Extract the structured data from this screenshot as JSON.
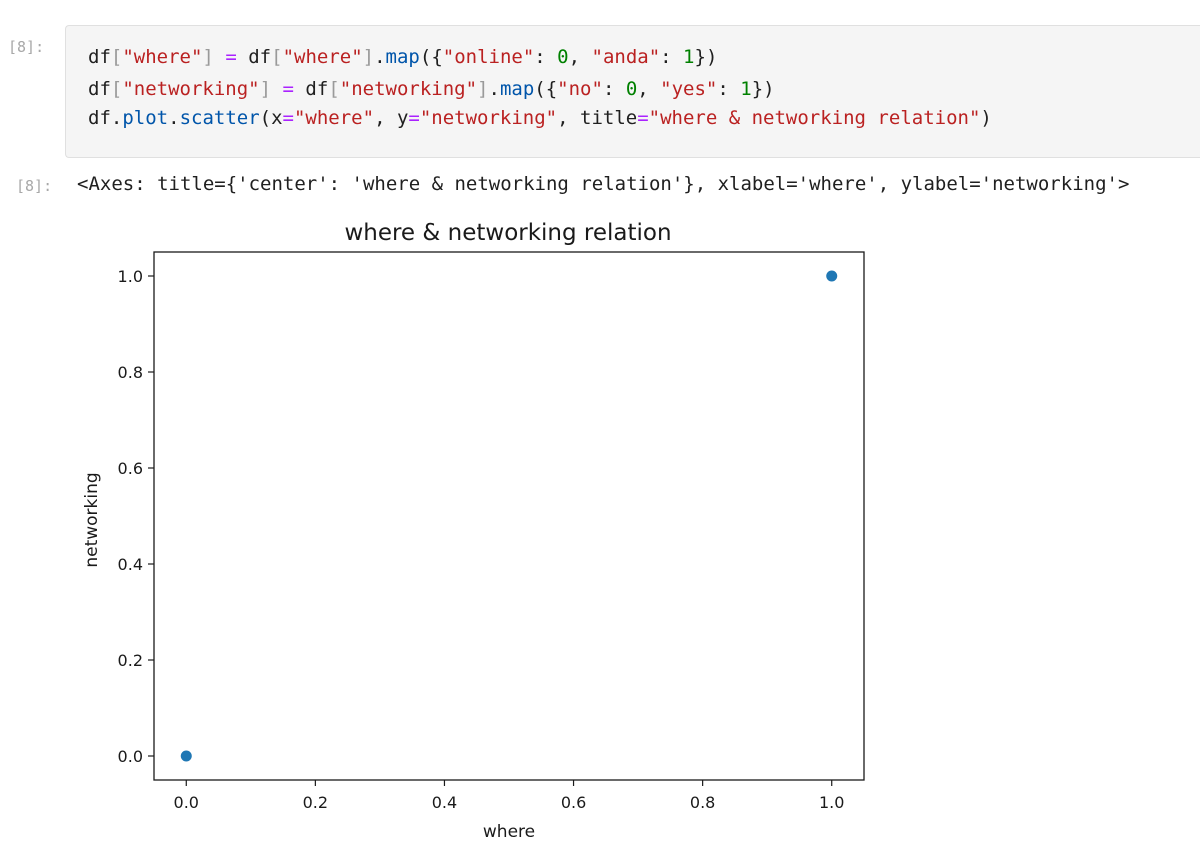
{
  "notebook": {
    "input_prompt": "[8]:",
    "output_prompt": "[8]:",
    "code_lines": [
      [
        {
          "t": "df",
          "c": "plain"
        },
        {
          "t": "[",
          "c": "br"
        },
        {
          "t": "\"where\"",
          "c": "str"
        },
        {
          "t": "]",
          "c": "br"
        },
        {
          "t": " ",
          "c": "plain"
        },
        {
          "t": "=",
          "c": "op"
        },
        {
          "t": " df",
          "c": "plain"
        },
        {
          "t": "[",
          "c": "br"
        },
        {
          "t": "\"where\"",
          "c": "str"
        },
        {
          "t": "]",
          "c": "br"
        },
        {
          "t": ".",
          "c": "plain"
        },
        {
          "t": "map",
          "c": "fn"
        },
        {
          "t": "({",
          "c": "plain"
        },
        {
          "t": "\"online\"",
          "c": "str"
        },
        {
          "t": ": ",
          "c": "plain"
        },
        {
          "t": "0",
          "c": "num"
        },
        {
          "t": ", ",
          "c": "plain"
        },
        {
          "t": "\"anda\"",
          "c": "str"
        },
        {
          "t": ": ",
          "c": "plain"
        },
        {
          "t": "1",
          "c": "num"
        },
        {
          "t": "})",
          "c": "plain"
        }
      ],
      [
        {
          "t": "df",
          "c": "plain"
        },
        {
          "t": "[",
          "c": "br"
        },
        {
          "t": "\"networking\"",
          "c": "str"
        },
        {
          "t": "]",
          "c": "br"
        },
        {
          "t": " ",
          "c": "plain"
        },
        {
          "t": "=",
          "c": "op"
        },
        {
          "t": " df",
          "c": "plain"
        },
        {
          "t": "[",
          "c": "br"
        },
        {
          "t": "\"networking\"",
          "c": "str"
        },
        {
          "t": "]",
          "c": "br"
        },
        {
          "t": ".",
          "c": "plain"
        },
        {
          "t": "map",
          "c": "fn"
        },
        {
          "t": "({",
          "c": "plain"
        },
        {
          "t": "\"no\"",
          "c": "str"
        },
        {
          "t": ": ",
          "c": "plain"
        },
        {
          "t": "0",
          "c": "num"
        },
        {
          "t": ", ",
          "c": "plain"
        },
        {
          "t": "\"yes\"",
          "c": "str"
        },
        {
          "t": ": ",
          "c": "plain"
        },
        {
          "t": "1",
          "c": "num"
        },
        {
          "t": "})",
          "c": "plain"
        }
      ],
      [
        {
          "t": "df",
          "c": "plain"
        },
        {
          "t": ".",
          "c": "plain"
        },
        {
          "t": "plot",
          "c": "fn"
        },
        {
          "t": ".",
          "c": "plain"
        },
        {
          "t": "scatter",
          "c": "fn"
        },
        {
          "t": "(x",
          "c": "plain"
        },
        {
          "t": "=",
          "c": "op"
        },
        {
          "t": "\"where\"",
          "c": "str"
        },
        {
          "t": ", y",
          "c": "plain"
        },
        {
          "t": "=",
          "c": "op"
        },
        {
          "t": "\"networking\"",
          "c": "str"
        },
        {
          "t": ", title",
          "c": "plain"
        },
        {
          "t": "=",
          "c": "op"
        },
        {
          "t": "\"where & networking relation\"",
          "c": "str"
        },
        {
          "t": ")",
          "c": "plain"
        }
      ]
    ],
    "output_text": "<Axes: title={'center': 'where & networking relation'}, xlabel='where', ylabel='networking'>"
  },
  "colors": {
    "marker": "#1f77b4",
    "string": "#ba2121",
    "operator": "#aa22ff",
    "number": "#008000",
    "function": "#0055aa"
  },
  "chart_data": {
    "type": "scatter",
    "title": "where & networking relation",
    "xlabel": "where",
    "ylabel": "networking",
    "x": [
      0,
      1
    ],
    "y": [
      0,
      1
    ],
    "xlim": [
      -0.05,
      1.05
    ],
    "ylim": [
      -0.05,
      1.05
    ],
    "xticks": [
      0.0,
      0.2,
      0.4,
      0.6,
      0.8,
      1.0
    ],
    "yticks": [
      0.0,
      0.2,
      0.4,
      0.6,
      0.8,
      1.0
    ],
    "xtick_labels": [
      "0.0",
      "0.2",
      "0.4",
      "0.6",
      "0.8",
      "1.0"
    ],
    "ytick_labels": [
      "0.0",
      "0.2",
      "0.4",
      "0.6",
      "0.8",
      "1.0"
    ],
    "grid": false,
    "legend": "none"
  }
}
